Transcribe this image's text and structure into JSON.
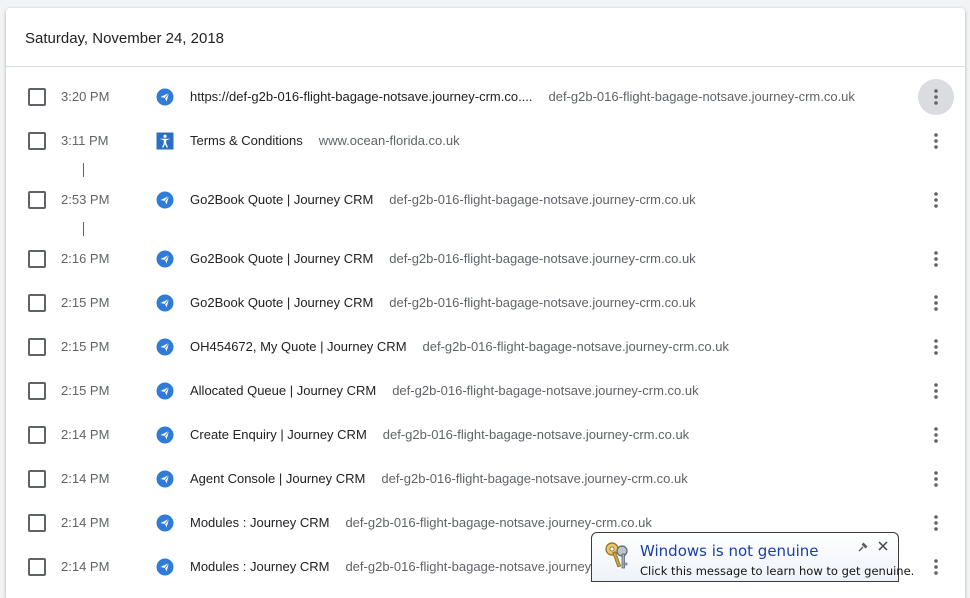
{
  "header": {
    "date": "Saturday, November 24, 2018"
  },
  "rows": [
    {
      "time": "3:20 PM",
      "title": "https://def-g2b-016-flight-bagage-notsave.journey-crm.co....",
      "domain": "def-g2b-016-flight-bagage-notsave.journey-crm.co.uk",
      "favicon": "send-icon",
      "active_menu": true
    },
    {
      "time": "3:11 PM",
      "title": "Terms & Conditions",
      "domain": "www.ocean-florida.co.uk",
      "favicon": "figure-icon",
      "active_menu": false
    },
    {
      "time": "2:53 PM",
      "title": "Go2Book Quote | Journey CRM",
      "domain": "def-g2b-016-flight-bagage-notsave.journey-crm.co.uk",
      "favicon": "send-icon",
      "active_menu": false
    },
    {
      "time": "2:16 PM",
      "title": "Go2Book Quote | Journey CRM",
      "domain": "def-g2b-016-flight-bagage-notsave.journey-crm.co.uk",
      "favicon": "send-icon",
      "active_menu": false
    },
    {
      "time": "2:15 PM",
      "title": "Go2Book Quote | Journey CRM",
      "domain": "def-g2b-016-flight-bagage-notsave.journey-crm.co.uk",
      "favicon": "send-icon",
      "active_menu": false
    },
    {
      "time": "2:15 PM",
      "title": "OH454672, My Quote | Journey CRM",
      "domain": "def-g2b-016-flight-bagage-notsave.journey-crm.co.uk",
      "favicon": "send-icon",
      "active_menu": false
    },
    {
      "time": "2:15 PM",
      "title": "Allocated Queue | Journey CRM",
      "domain": "def-g2b-016-flight-bagage-notsave.journey-crm.co.uk",
      "favicon": "send-icon",
      "active_menu": false
    },
    {
      "time": "2:14 PM",
      "title": "Create Enquiry | Journey CRM",
      "domain": "def-g2b-016-flight-bagage-notsave.journey-crm.co.uk",
      "favicon": "send-icon",
      "active_menu": false
    },
    {
      "time": "2:14 PM",
      "title": "Agent Console | Journey CRM",
      "domain": "def-g2b-016-flight-bagage-notsave.journey-crm.co.uk",
      "favicon": "send-icon",
      "active_menu": false
    },
    {
      "time": "2:14 PM",
      "title": "Modules : Journey CRM",
      "domain": "def-g2b-016-flight-bagage-notsave.journey-crm.co.uk",
      "favicon": "send-icon",
      "active_menu": false
    },
    {
      "time": "2:14 PM",
      "title": "Modules : Journey CRM",
      "domain": "def-g2b-016-flight-bagage-notsave.journey-",
      "favicon": "send-icon",
      "active_menu": false
    }
  ],
  "notification": {
    "title": "Windows is not genuine",
    "message": "Click this message to learn how to get genuine.",
    "icon": "keys-icon"
  },
  "colors": {
    "favicon_blue": "#2f7bd6",
    "favicon_square": "#2a6fc4",
    "text_primary": "#202124",
    "text_secondary": "#5f6368",
    "notification_title": "#1a3ea8"
  }
}
